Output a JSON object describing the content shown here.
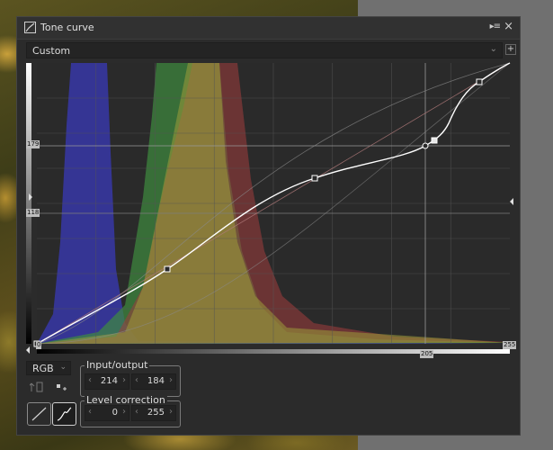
{
  "window": {
    "title": "Tone curve"
  },
  "preset": {
    "value": "Custom"
  },
  "markers": {
    "left_marker_upper": "179",
    "left_marker_lower": "118",
    "bottom_left": "0",
    "bottom_mid": "205",
    "bottom_right": "255",
    "curve_left": "0"
  },
  "channel": {
    "value": "RGB"
  },
  "input_output": {
    "label": "Input/output",
    "input": "214",
    "output": "184"
  },
  "level_correction": {
    "label": "Level correction",
    "min": "0",
    "max": "255"
  },
  "colors": {
    "panel": "#2b2b2b",
    "curve": "#ffffff",
    "red": "#a03c3c",
    "green": "#3e8c3e",
    "blue": "#3a3ab8",
    "yellow": "#9c9c3a"
  }
}
